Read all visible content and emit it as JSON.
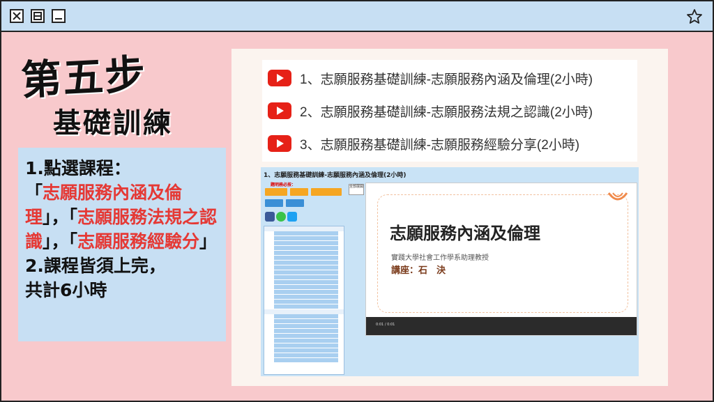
{
  "window": {
    "buttons": [
      "close-icon",
      "restore-icon",
      "minimize-icon"
    ],
    "favorite_icon": "star-icon"
  },
  "slide": {
    "step": "第五步",
    "subtitle": "基礎訓練",
    "instructions": {
      "line1": "1.點選課程：",
      "q1_open": "「",
      "c1": "志願服務內涵及倫理",
      "q1_close": "」，「",
      "c2": "志願服務法規之認識",
      "q2_close": "」，「",
      "c3": "志願服務經驗分",
      "q3_close": "」",
      "line2": "2.課程皆須上完，",
      "line3": "共計6小時"
    }
  },
  "courses": [
    {
      "label": "1、志願服務基礎訓練-志願服務內涵及倫理(2小時)"
    },
    {
      "label": "2、志願服務基礎訓練-志願服務法規之認識(2小時)"
    },
    {
      "label": "3、志願服務基礎訓練-志願服務經驗分享(2小時)"
    }
  ],
  "screenshot": {
    "title": "1、志願服務基礎訓練-志願服務內涵及倫理(2小時)",
    "must_read": "題明務必按：",
    "share": "全部展開",
    "video_title": "志願服務內涵及倫理",
    "video_sub": "實踐大學社會工作學系助理教授",
    "video_lecturer": "講座：石　決",
    "time": "0:01 / 0:01",
    "colors": {
      "accent_red": "#e53935",
      "pink_bg": "#f8c9cc",
      "blue_bg": "#c7dff3"
    }
  }
}
